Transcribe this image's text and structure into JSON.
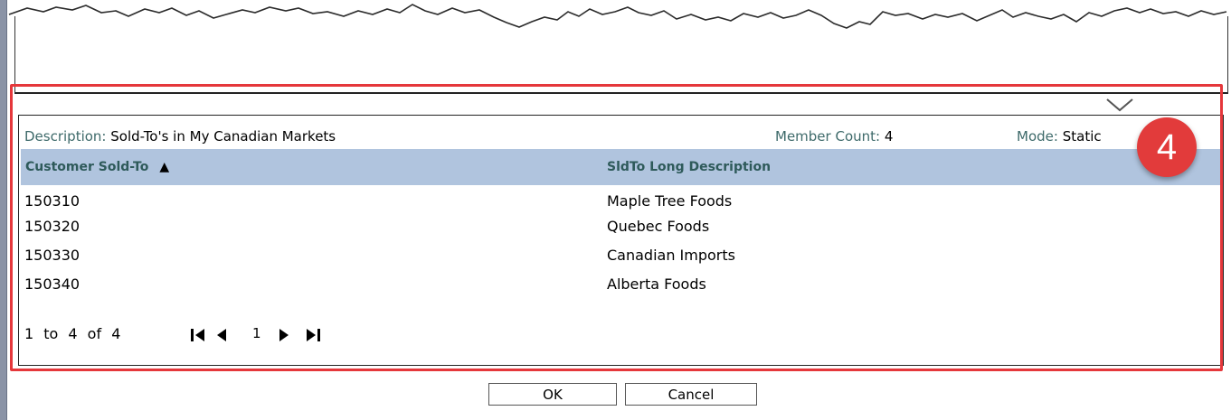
{
  "info": {
    "description_label": "Description:",
    "description_value": "Sold-To's in My Canadian Markets",
    "member_count_label": "Member Count:",
    "member_count_value": "4",
    "mode_label": "Mode:",
    "mode_value": "Static"
  },
  "table": {
    "columns": [
      "Customer Sold-To",
      "SldTo Long Description"
    ],
    "sort_indicator": "▲",
    "rows": [
      [
        "150310",
        "Maple Tree Foods"
      ],
      [
        "150320",
        "Quebec Foods"
      ],
      [
        "150330",
        "Canadian Imports"
      ],
      [
        "150340",
        "Alberta Foods"
      ]
    ]
  },
  "pager": {
    "range_text": "1 to 4 of 4",
    "current_page": "1",
    "icons": [
      "first-page-icon",
      "previous-page-icon",
      "next-page-icon",
      "last-page-icon"
    ]
  },
  "actions": {
    "ok_label": "OK",
    "cancel_label": "Cancel"
  },
  "callout": {
    "step_number": "4",
    "color": "#e23b3b"
  },
  "colors": {
    "highlight": "#e5373b",
    "header_background": "#b0c4de",
    "label_text": "#3e6a6a"
  }
}
